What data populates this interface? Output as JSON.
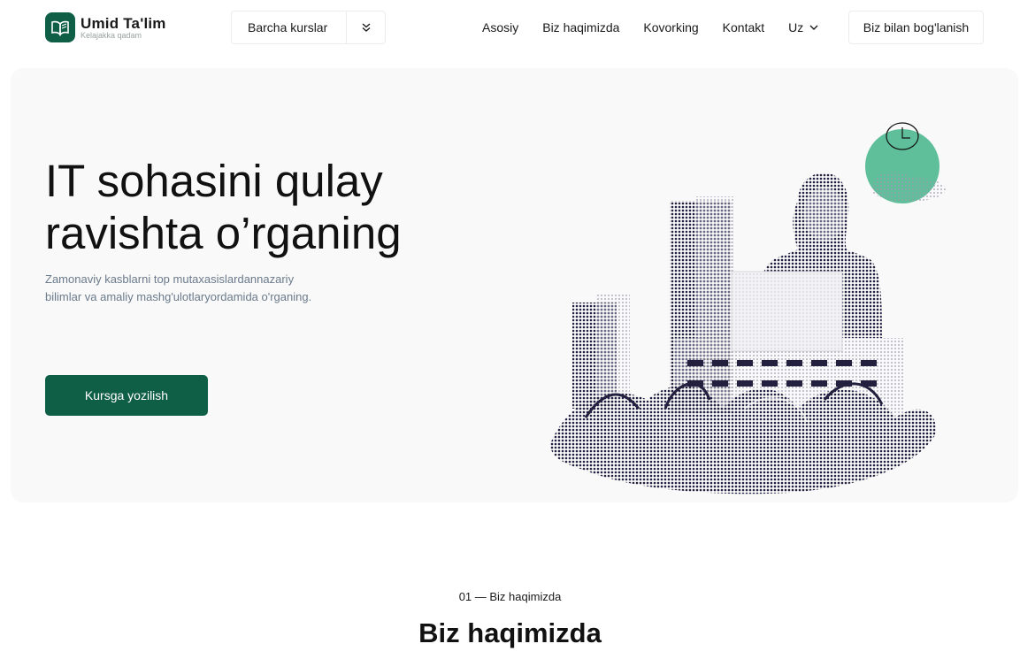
{
  "brand": {
    "name": "Umid Ta'lim",
    "tagline": "Kelajakka qadam",
    "color": "#0f5e46"
  },
  "header": {
    "courses_dropdown": {
      "label": "Barcha kurslar",
      "icon": "double-chevron-down-icon"
    },
    "nav": [
      {
        "label": "Asosiy"
      },
      {
        "label": "Biz haqimizda"
      },
      {
        "label": "Kovorking"
      },
      {
        "label": "Kontakt"
      }
    ],
    "language": {
      "label": "Uz",
      "icon": "chevron-down-icon"
    },
    "contact_button": "Biz bilan bog'lanish"
  },
  "hero": {
    "title_line1": "IT sohasini qulay",
    "title_line2": "ravishta o’rganing",
    "subtitle_line1": "Zamonaviy kasblarni top mutaxasislardannazariy",
    "subtitle_line2": "bilimlar va amaliy mashg'ulotlaryordamida o'rganing.",
    "cta": "Kursga yozilish",
    "illustration": "halftone-collage-woman-laptop-city-plants",
    "accent_circle_color": "#5fbf9a"
  },
  "about": {
    "kicker": "01 — Biz haqimizda",
    "title": "Biz haqimizda"
  }
}
